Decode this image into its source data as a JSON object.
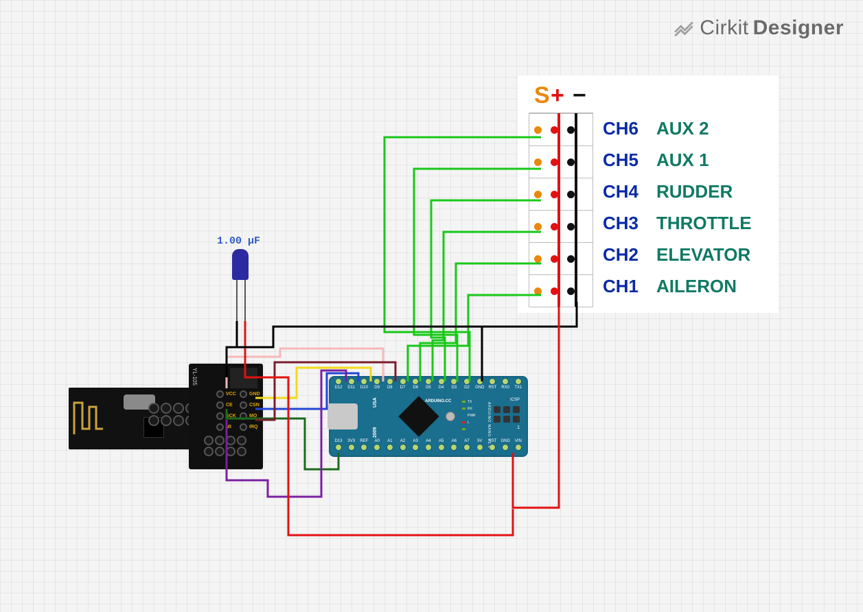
{
  "brand": {
    "name": "Cirkit",
    "designer": "Designer"
  },
  "capacitor": {
    "label": "1.00 µF"
  },
  "receiver": {
    "header": {
      "signal": "S",
      "power": "+",
      "ground": "−"
    },
    "channels": [
      {
        "ch": "CH6",
        "fn": "AUX 2"
      },
      {
        "ch": "CH5",
        "fn": "AUX 1"
      },
      {
        "ch": "CH4",
        "fn": "RUDDER"
      },
      {
        "ch": "CH3",
        "fn": "THROTTLE"
      },
      {
        "ch": "CH2",
        "fn": "ELEVATOR"
      },
      {
        "ch": "CH1",
        "fn": "AILERON"
      }
    ]
  },
  "arduino": {
    "board": "ARDUINO.CC",
    "model_lines": [
      "ARDUINO",
      "NANO",
      "V3.0"
    ],
    "side_label": "2009",
    "side_label2": "USA",
    "icsp": "ICSP",
    "one": "1",
    "leds": [
      "TX",
      "RX",
      "PWR",
      "L"
    ],
    "top_pins": [
      "D12",
      "D11",
      "D10",
      "D9",
      "D8",
      "D7",
      "D6",
      "D5",
      "D4",
      "D3",
      "D2",
      "GND",
      "RST",
      "RX0",
      "TX1"
    ],
    "bottom_pins": [
      "D13",
      "3V3",
      "REF",
      "A0",
      "A1",
      "A2",
      "A3",
      "A4",
      "A5",
      "A6",
      "A7",
      "5V",
      "RST",
      "GND",
      "VIN"
    ]
  },
  "adapter": {
    "side": "YL-105",
    "pins": [
      "VCC",
      "GND",
      "CE",
      "CSN",
      "SCK",
      "MO",
      "MI",
      "IRQ"
    ]
  },
  "connections": {
    "signal_wires": [
      {
        "color": "green",
        "from": "Arduino D2",
        "to": "Receiver CH6 S"
      },
      {
        "color": "green",
        "from": "Arduino D3",
        "to": "Receiver CH5 S"
      },
      {
        "color": "green",
        "from": "Arduino D4",
        "to": "Receiver CH4 S"
      },
      {
        "color": "green",
        "from": "Arduino D5",
        "to": "Receiver CH3 S"
      },
      {
        "color": "green",
        "from": "Arduino D6",
        "to": "Receiver CH2 S"
      },
      {
        "color": "green",
        "from": "Arduino D7",
        "to": "Receiver CH1 S"
      }
    ],
    "power_wires": [
      {
        "color": "red",
        "from": "Arduino VIN",
        "to": "Receiver + bus"
      },
      {
        "color": "black",
        "from": "Arduino GND (top)",
        "to": "Receiver − bus"
      }
    ],
    "nrf_adapter_wires": [
      {
        "color": "red",
        "from": "Adapter VCC",
        "to": "Arduino VIN"
      },
      {
        "color": "black",
        "from": "Adapter GND",
        "to": "Arduino GND / Cap −"
      },
      {
        "color": "pink",
        "from": "Adapter CE",
        "to": "Arduino D9"
      },
      {
        "color": "yellow",
        "from": "Adapter CSN",
        "to": "Arduino D10"
      },
      {
        "color": "darkgreen",
        "from": "Adapter SCK",
        "to": "Arduino D13"
      },
      {
        "color": "blue",
        "from": "Adapter MO",
        "to": "Arduino D11"
      },
      {
        "color": "purple",
        "from": "Adapter MI",
        "to": "Arduino D12"
      },
      {
        "color": "maroon",
        "from": "Adapter IRQ",
        "to": "Arduino D8"
      }
    ],
    "capacitor_wires": [
      {
        "color": "red",
        "from": "Cap +",
        "to": "Adapter VCC"
      },
      {
        "color": "black",
        "from": "Cap −",
        "to": "Adapter GND"
      }
    ]
  },
  "chart_data": {
    "type": "circuit-diagram",
    "components": [
      {
        "id": "arduino_nano",
        "type": "Arduino Nano V3.0"
      },
      {
        "id": "nrf24l01",
        "type": "NRF24L01 2.4GHz radio module"
      },
      {
        "id": "nrf_adapter",
        "type": "YL-105 NRF24L01 3.3V regulator adapter"
      },
      {
        "id": "cap",
        "type": "Electrolytic capacitor",
        "value_uF": 1.0
      },
      {
        "id": "rc_receiver",
        "type": "6-channel RC receiver header (S/+/−)"
      }
    ],
    "nets": [
      {
        "name": "CH6_SIG",
        "nodes": [
          "arduino_nano.D2",
          "rc_receiver.CH6.S"
        ]
      },
      {
        "name": "CH5_SIG",
        "nodes": [
          "arduino_nano.D3",
          "rc_receiver.CH5.S"
        ]
      },
      {
        "name": "CH4_SIG",
        "nodes": [
          "arduino_nano.D4",
          "rc_receiver.CH4.S"
        ]
      },
      {
        "name": "CH3_SIG",
        "nodes": [
          "arduino_nano.D5",
          "rc_receiver.CH3.S"
        ]
      },
      {
        "name": "CH2_SIG",
        "nodes": [
          "arduino_nano.D6",
          "rc_receiver.CH2.S"
        ]
      },
      {
        "name": "CH1_SIG",
        "nodes": [
          "arduino_nano.D7",
          "rc_receiver.CH1.S"
        ]
      },
      {
        "name": "VIN",
        "nodes": [
          "arduino_nano.VIN",
          "rc_receiver.+",
          "nrf_adapter.VCC",
          "cap.+"
        ]
      },
      {
        "name": "GND",
        "nodes": [
          "arduino_nano.GND",
          "rc_receiver.-",
          "nrf_adapter.GND",
          "cap.-"
        ]
      },
      {
        "name": "NRF_CE",
        "nodes": [
          "nrf_adapter.CE",
          "arduino_nano.D9"
        ]
      },
      {
        "name": "NRF_CSN",
        "nodes": [
          "nrf_adapter.CSN",
          "arduino_nano.D10"
        ]
      },
      {
        "name": "SPI_SCK",
        "nodes": [
          "nrf_adapter.SCK",
          "arduino_nano.D13"
        ]
      },
      {
        "name": "SPI_MOSI",
        "nodes": [
          "nrf_adapter.MO",
          "arduino_nano.D11"
        ]
      },
      {
        "name": "SPI_MISO",
        "nodes": [
          "nrf_adapter.MI",
          "arduino_nano.D12"
        ]
      },
      {
        "name": "NRF_IRQ",
        "nodes": [
          "nrf_adapter.IRQ",
          "arduino_nano.D8"
        ]
      }
    ]
  }
}
